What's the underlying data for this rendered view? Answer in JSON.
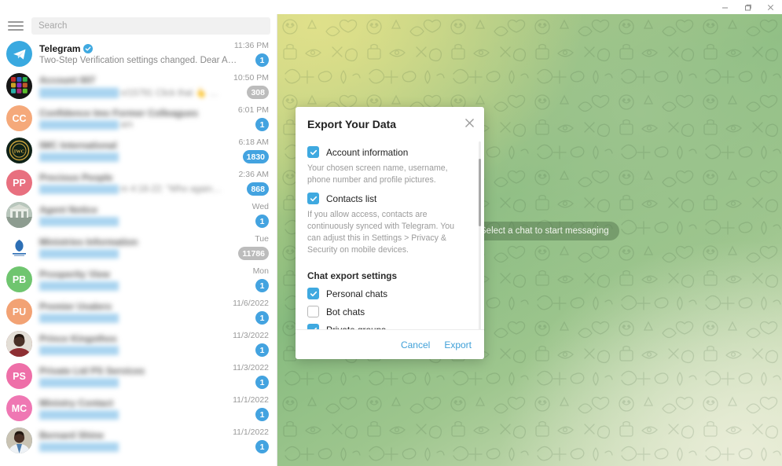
{
  "window": {
    "buttons": [
      {
        "name": "minimize-button",
        "glyph": "minimize"
      },
      {
        "name": "restore-button",
        "glyph": "restore"
      },
      {
        "name": "close-button",
        "glyph": "close"
      }
    ]
  },
  "sidebar": {
    "menu_icon": "hamburger-menu-icon",
    "search": {
      "placeholder": "Search",
      "value": ""
    },
    "chats": [
      {
        "name": "Telegram",
        "verified": true,
        "blurred": false,
        "message": "Two-Step Verification settings changed. Dear Amos, your Two-Step Veri…",
        "time": "11:36 PM",
        "badge": "1",
        "badge_muted": false,
        "avatar": {
          "type": "logo",
          "color": "#39a9e0",
          "initials": ""
        }
      },
      {
        "name": "Account 007",
        "verified": false,
        "blurred": true,
        "message": "n/15791 Click that 👆 …",
        "time": "10:50 PM",
        "badge": "308",
        "badge_muted": true,
        "avatar": {
          "type": "mosaic",
          "color": "#161616",
          "initials": ""
        }
      },
      {
        "name": "Confidence Imo Former Colleagues",
        "verified": false,
        "blurred": true,
        "message": "am",
        "time": "6:01 PM",
        "badge": "1",
        "badge_muted": false,
        "avatar": {
          "type": "initials",
          "color": "#f5a97a",
          "initials": "CC"
        }
      },
      {
        "name": "IWC International",
        "verified": false,
        "blurred": true,
        "message": "",
        "time": "6:18 AM",
        "badge": "1830",
        "badge_muted": false,
        "avatar": {
          "type": "emblem",
          "color": "#0f2218",
          "initials": "IWC"
        }
      },
      {
        "name": "Precious People",
        "verified": false,
        "blurred": true,
        "message": "m 4:18-22: “Who again…",
        "time": "2:36 AM",
        "badge": "868",
        "badge_muted": false,
        "avatar": {
          "type": "initials",
          "color": "#e8707f",
          "initials": "PP"
        }
      },
      {
        "name": "Agent Notice",
        "verified": false,
        "blurred": true,
        "message": "",
        "time": "Wed",
        "badge": "1",
        "badge_muted": false,
        "avatar": {
          "type": "photo",
          "color": "#9aa8a0",
          "initials": ""
        }
      },
      {
        "name": "Ministries Information",
        "verified": false,
        "blurred": true,
        "message": "",
        "time": "Tue",
        "badge": "11786",
        "badge_muted": true,
        "avatar": {
          "type": "crest",
          "color": "#ffffff",
          "initials": ""
        }
      },
      {
        "name": "Prosperity View",
        "verified": false,
        "blurred": true,
        "message": "",
        "time": "Mon",
        "badge": "1",
        "badge_muted": false,
        "avatar": {
          "type": "initials",
          "color": "#6fc56f",
          "initials": "PB"
        }
      },
      {
        "name": "Premier Uvalero",
        "verified": false,
        "blurred": true,
        "message": "",
        "time": "11/6/2022",
        "badge": "1",
        "badge_muted": false,
        "avatar": {
          "type": "initials",
          "color": "#f2a274",
          "initials": "PU"
        }
      },
      {
        "name": "Prince Kingsthos",
        "verified": false,
        "blurred": true,
        "message": "",
        "time": "11/3/2022",
        "badge": "1",
        "badge_muted": false,
        "avatar": {
          "type": "photo-man",
          "color": "#8a4a44",
          "initials": ""
        }
      },
      {
        "name": "Private Ltd PS Services",
        "verified": false,
        "blurred": true,
        "message": "",
        "time": "11/3/2022",
        "badge": "1",
        "badge_muted": false,
        "avatar": {
          "type": "initials",
          "color": "#ee6fa8",
          "initials": "PS"
        }
      },
      {
        "name": "Ministry Contact",
        "verified": false,
        "blurred": true,
        "message": "",
        "time": "11/1/2022",
        "badge": "1",
        "badge_muted": false,
        "avatar": {
          "type": "initials",
          "color": "#ef77b3",
          "initials": "MC"
        }
      },
      {
        "name": "Bernard Shine",
        "verified": false,
        "blurred": true,
        "message": "",
        "time": "11/1/2022",
        "badge": "1",
        "badge_muted": false,
        "avatar": {
          "type": "photo-seated",
          "color": "#4f6f8a",
          "initials": ""
        }
      }
    ]
  },
  "chat_area": {
    "placeholder_text": "Select a chat to start messaging",
    "wallpaper_colors": [
      "#cdd685",
      "#87bb7f",
      "#9ec68e",
      "#dfe6c8"
    ]
  },
  "modal": {
    "title": "Export Your Data",
    "close_icon": "close-icon",
    "options": [
      {
        "label": "Account information",
        "checked": true,
        "description": "Your chosen screen name, username, phone number and profile pictures."
      },
      {
        "label": "Contacts list",
        "checked": true,
        "description": "If you allow access, contacts are continuously synced with Telegram. You can adjust this in Settings > Privacy & Security on mobile devices."
      }
    ],
    "section_title": "Chat export settings",
    "chat_options": [
      {
        "label": "Personal chats",
        "checked": true
      },
      {
        "label": "Bot chats",
        "checked": false
      },
      {
        "label": "Private groups",
        "checked": true
      }
    ],
    "cancel_label": "Cancel",
    "export_label": "Export",
    "accent_color": "#3fa9e0"
  }
}
